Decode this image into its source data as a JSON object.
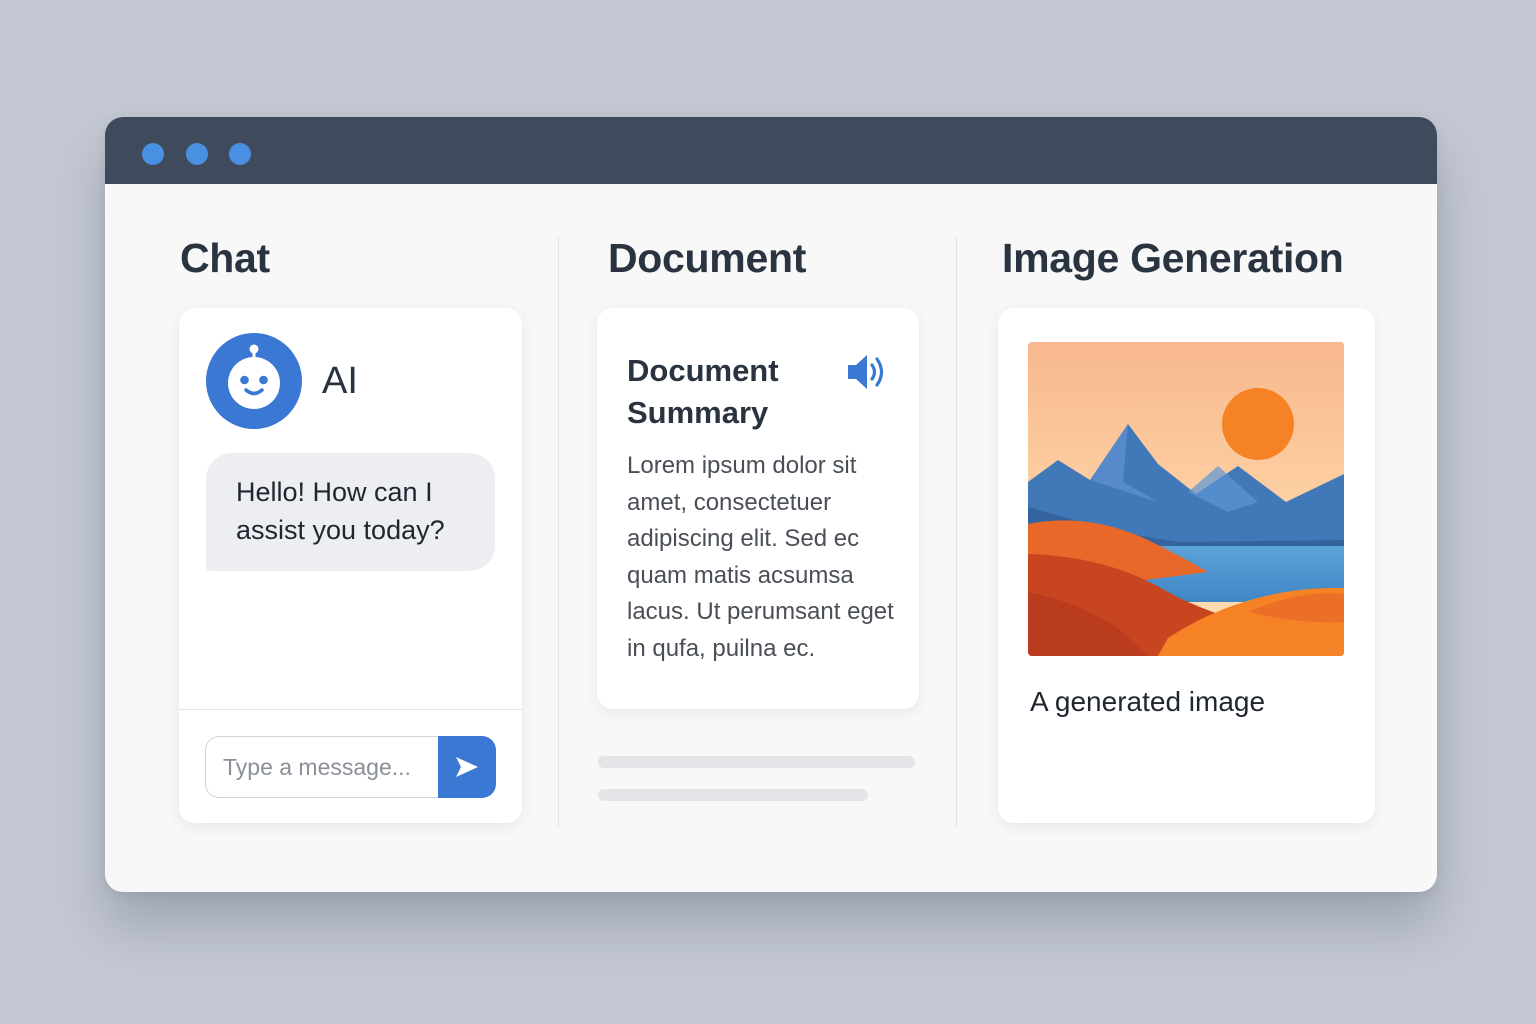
{
  "window": {
    "traffic_lights": [
      "window-dot-1",
      "window-dot-2",
      "window-dot-3"
    ]
  },
  "chat": {
    "title": "Chat",
    "bot_name": "AI",
    "message": "Hello! How can I assist you today?",
    "input_placeholder": "Type a message...",
    "avatar_icon": "robot-face-icon",
    "send_icon": "send-arrow-icon"
  },
  "document": {
    "title": "Document",
    "card_title": "Document Summary",
    "body": "Lorem ipsum dolor sit amet, consectetuer adipiscing elit. Sed ec quam matis acsumsa lacus. Ut perumsant eget in qufa, puilna ec.",
    "speaker_icon": "speaker-icon"
  },
  "image_generation": {
    "title": "Image Generation",
    "caption": "A generated image",
    "image_icon": "landscape-image"
  },
  "colors": {
    "accent": "#3a78d4",
    "titlebar": "#3f4b5c",
    "background": "#c3c8d2"
  }
}
